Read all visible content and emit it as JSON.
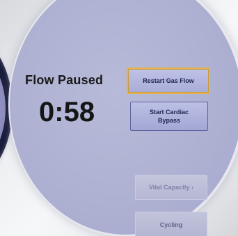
{
  "status": {
    "title": "Flow Paused",
    "timer": "0:58"
  },
  "buttons": {
    "restart_gas_flow": "Restart Gas Flow",
    "start_cardiac_bypass": "Start Cardiac Bypass",
    "vital_capacity": "Vital Capacity ›",
    "cycling": "Cycling"
  },
  "colors": {
    "screen_background": "#aeb1d2",
    "focus_highlight": "#e8b24a",
    "button_text": "#1d2250",
    "disabled_text": "#7f82a6"
  }
}
